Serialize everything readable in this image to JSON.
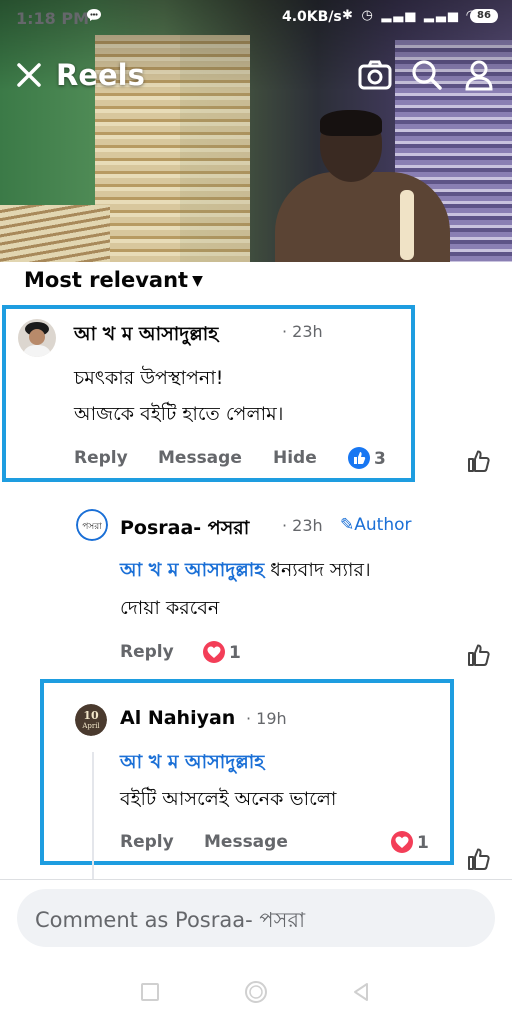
{
  "status_bar": {
    "time": "1:18 PM",
    "speed": "4.0KB/s",
    "battery": "86"
  },
  "header": {
    "title": "Reels"
  },
  "filter": {
    "label": "Most relevant"
  },
  "comments": [
    {
      "author": "আ খ ম আসাদুল্লাহ",
      "time": "23h",
      "lines": [
        "চমৎকার উপস্থাপনা!",
        "আজকে বইটি হাতে পেলাম।"
      ],
      "actions": [
        "Reply",
        "Message",
        "Hide"
      ],
      "reaction_count": "3",
      "reaction": "like",
      "highlighted": true
    },
    {
      "author": "Posraa- পসরা",
      "time": "23h",
      "badge": "Author",
      "mention": "আ খ ম আসাদুল্লাহ",
      "lines": [
        "ধন্যবাদ স্যার।",
        "দোয়া করবেন"
      ],
      "actions": [
        "Reply"
      ],
      "reaction_count": "1",
      "reaction": "love",
      "avatar_text": "পসরা"
    },
    {
      "author": "Al Nahiyan",
      "time": "19h",
      "mention": "আ খ ম আসাদুল্লাহ",
      "lines": [
        "বইটি আসলেই অনেক ভালো"
      ],
      "actions": [
        "Reply",
        "Message"
      ],
      "reaction_count": "1",
      "reaction": "love",
      "avatar_text_top": "10",
      "avatar_text_bottom": "April",
      "highlighted": true
    }
  ],
  "composer": {
    "placeholder": "Comment as Posraa- পসরা"
  },
  "colors": {
    "highlight": "#1e9de0",
    "mention": "#1a6fd6",
    "like": "#1877f2",
    "love": "#f33e58"
  }
}
